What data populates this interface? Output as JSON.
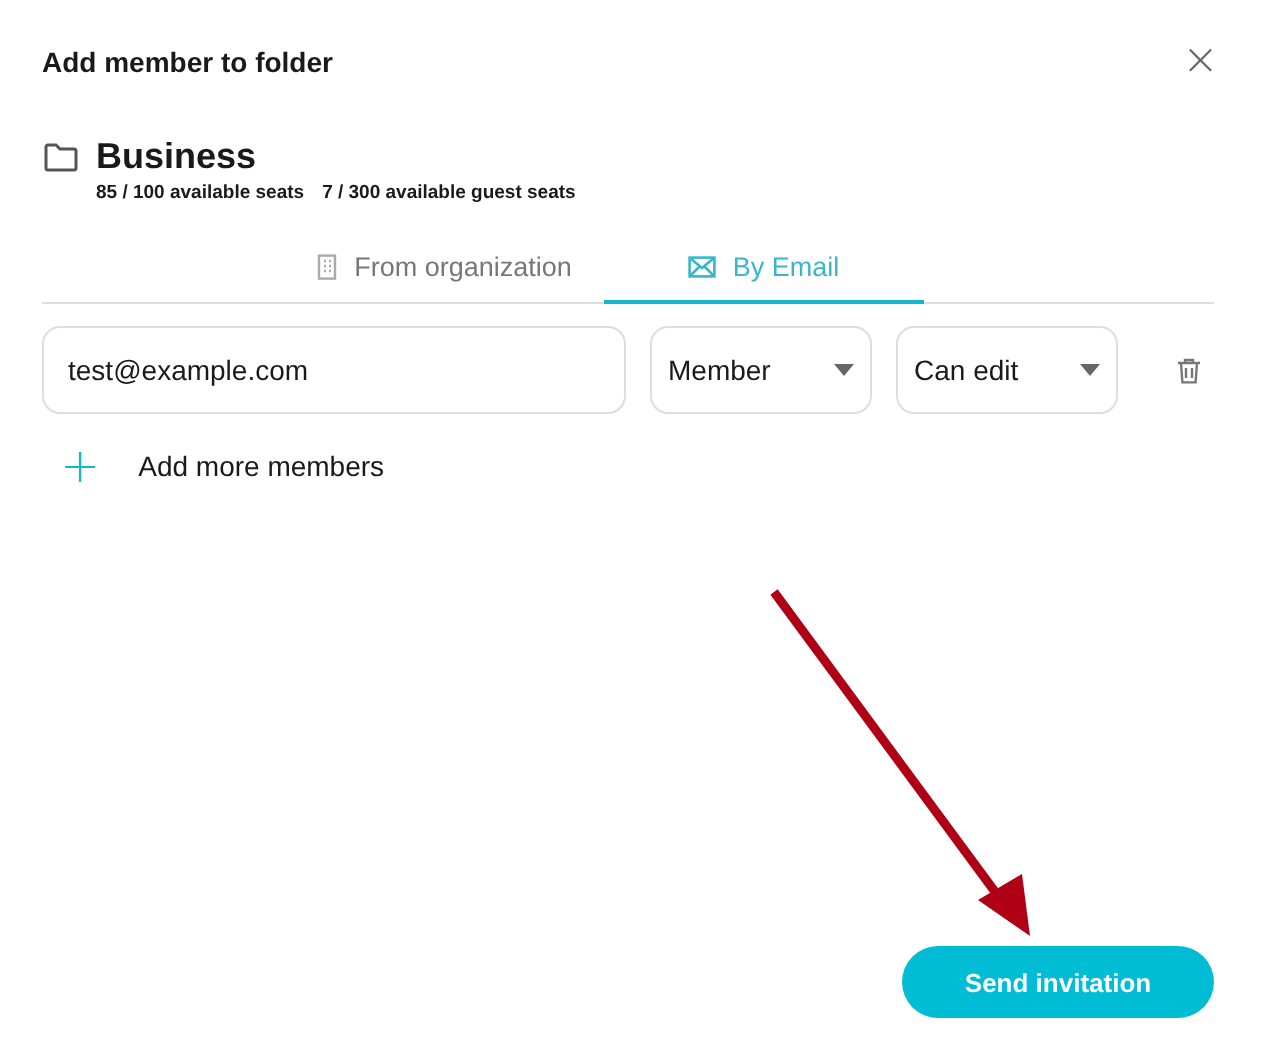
{
  "dialog": {
    "title": "Add member to folder",
    "close_label": "×"
  },
  "folder": {
    "name": "Business",
    "seats": "85 / 100 available seats",
    "guest_seats": "7 / 300 available guest seats"
  },
  "tabs": [
    {
      "label": "From organization",
      "kind": "building",
      "selected": false
    },
    {
      "label": "By Email",
      "kind": "mail",
      "selected": true
    }
  ],
  "invite_row": {
    "email": "test@example.com",
    "role": "Member",
    "permission": "Can edit"
  },
  "add_more": {
    "label": "Add more members",
    "icon": "+"
  },
  "send_button": "Send invitation"
}
